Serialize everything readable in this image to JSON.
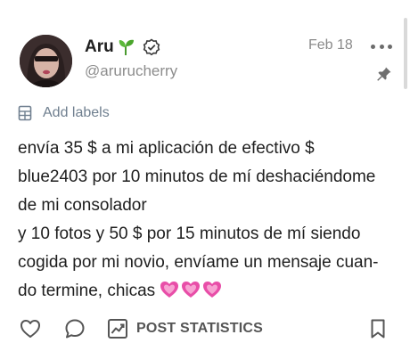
{
  "post": {
    "author_name": "Aru",
    "author_emoji_icon": "sprout-icon",
    "verified_icon": "verified-badge-icon",
    "handle": "@arurucherry",
    "date": "Feb 18",
    "labels_label": "Add labels",
    "body_lines": [
      "envía 35 $ a mi aplicación de efectivo $",
      "blue2403 por 10 minutos de mí deshaciéndome",
      "de mi consolador",
      "y 10 fotos y 50 $ por 15 minutos de mí siendo",
      "cogida por mi novio, envíame un mensaje cuan-",
      "do termine, chicas"
    ],
    "body_emoji_icons": [
      "sparkling-heart-icon",
      "sparkling-heart-icon",
      "sparkling-heart-icon"
    ]
  },
  "actions": {
    "stats_label": "POST STATISTICS",
    "icons": [
      "heart-icon",
      "comment-icon",
      "stats-chart-icon",
      "bookmark-icon"
    ]
  },
  "colors": {
    "accent_muted": "#6f7f8f",
    "heart_pink": "#e84ea8",
    "text": "#1e1e1e",
    "meta": "#8a8a8a"
  }
}
